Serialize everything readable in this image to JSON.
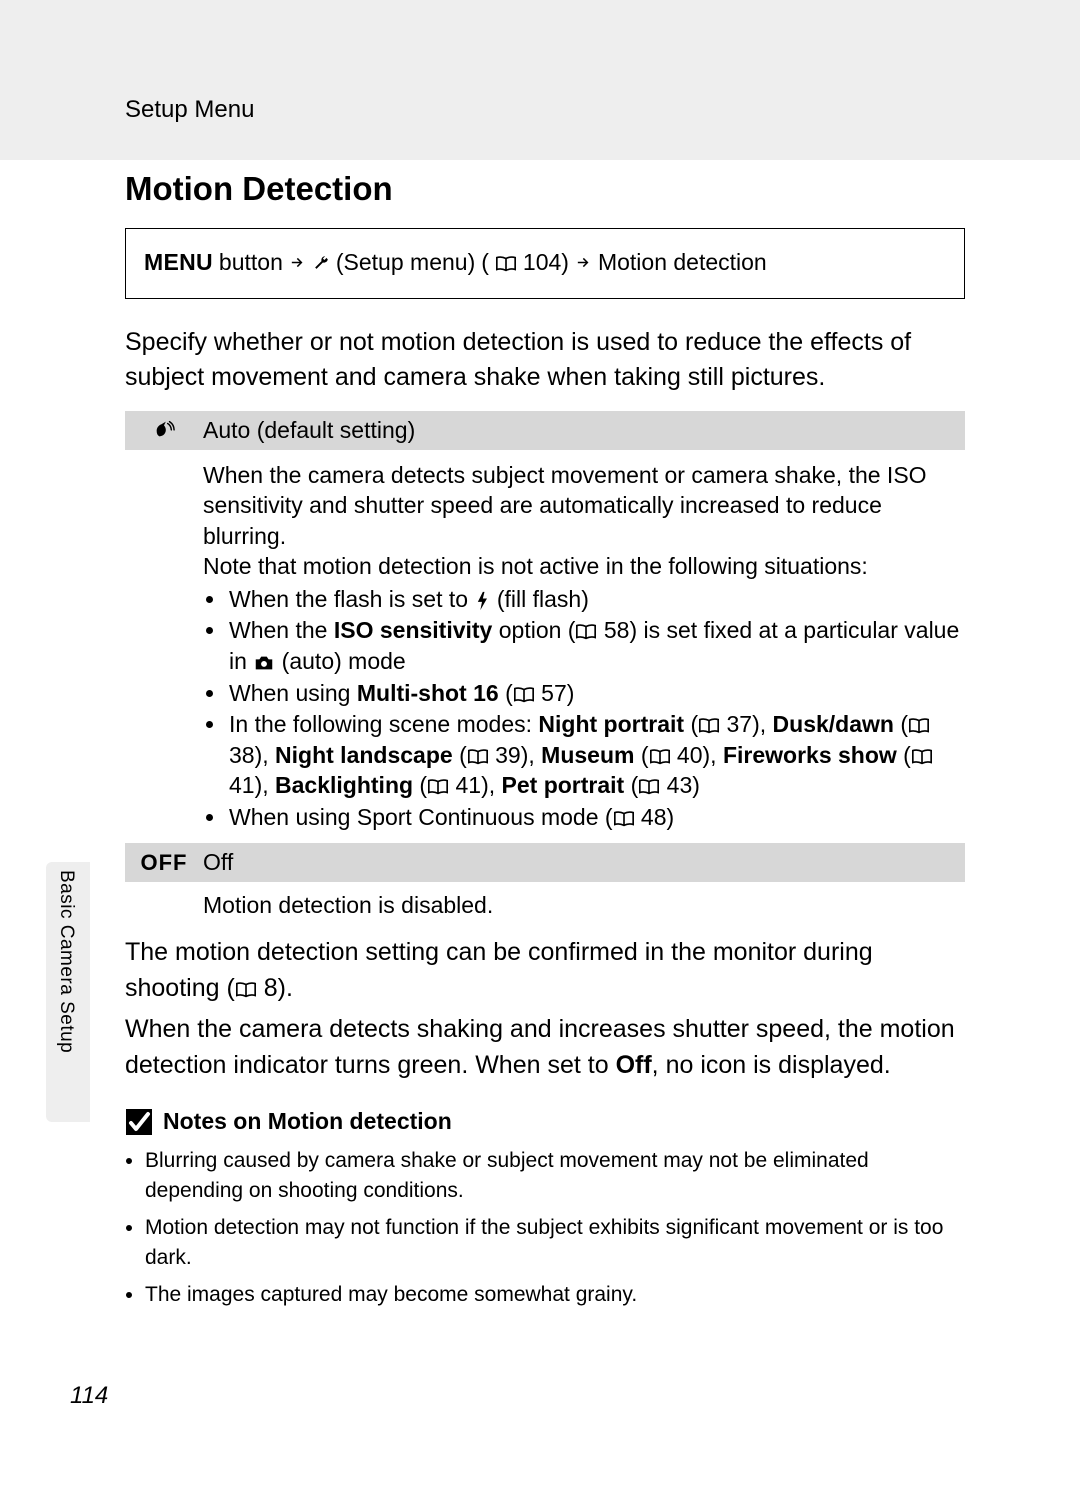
{
  "header": {
    "breadcrumb": "Setup Menu"
  },
  "title": "Motion Detection",
  "nav": {
    "menu_word": "MENU",
    "button_word": "button",
    "setup_menu": "(Setup menu)",
    "ref104": "104)",
    "target": "Motion detection"
  },
  "intro": "Specify whether or not motion detection is used to reduce the effects of subject movement and camera shake when taking still pictures.",
  "options": {
    "auto": {
      "title": "Auto (default setting)",
      "para1": "When the camera detects subject movement or camera shake, the ISO sensitivity and shutter speed are automatically increased to reduce blurring.",
      "para2": "Note that motion detection is not active in the following situations:",
      "b1a": "When the flash is set to ",
      "b1b": " (fill flash)",
      "b2a": "When the ",
      "b2_iso": "ISO sensitivity",
      "b2b": " option (",
      "b2_ref": " 58) is set fixed at a particular value in ",
      "b2c": " (auto) mode",
      "b3a": "When using ",
      "b3_ms": "Multi-shot 16",
      "b3b": " (",
      "b3_ref": " 57)",
      "b4a": "In the following scene modes: ",
      "b4_np": "Night portrait",
      "b4_np_ref": " 37), ",
      "b4_dd": "Dusk/dawn",
      "b4_dd_ref": " 38), ",
      "b4_nl": "Night landscape",
      "b4_nl_ref": " 39), ",
      "b4_mu": "Museum",
      "b4_mu_ref": " 40), ",
      "b4_fw": "Fireworks show",
      "b4_fw_ref": " 41), ",
      "b4_bl": "Backlighting",
      "b4_bl_ref": " 41), ",
      "b4_pp": "Pet portrait",
      "b4_pp_ref": " 43)",
      "b5a": "When using Sport Continuous mode (",
      "b5_ref": " 48)"
    },
    "off": {
      "icon_text": "OFF",
      "title": "Off",
      "body": "Motion detection is disabled."
    }
  },
  "post": {
    "p1a": "The motion detection setting can be confirmed in the monitor during shooting (",
    "p1_ref": " 8).",
    "p2a": "When the camera detects shaking and increases shutter speed, the motion detection indicator turns green. When set to ",
    "p2_off": "Off",
    "p2b": ", no icon is displayed."
  },
  "side_label": "Basic Camera Setup",
  "notes": {
    "title": "Notes on Motion detection",
    "n1": "Blurring caused by camera shake or subject movement may not be eliminated depending on shooting conditions.",
    "n2": "Motion detection may not function if the subject exhibits significant movement or is too dark.",
    "n3": "The images captured may become somewhat grainy."
  },
  "page_number": "114",
  "paren_open": " ("
}
